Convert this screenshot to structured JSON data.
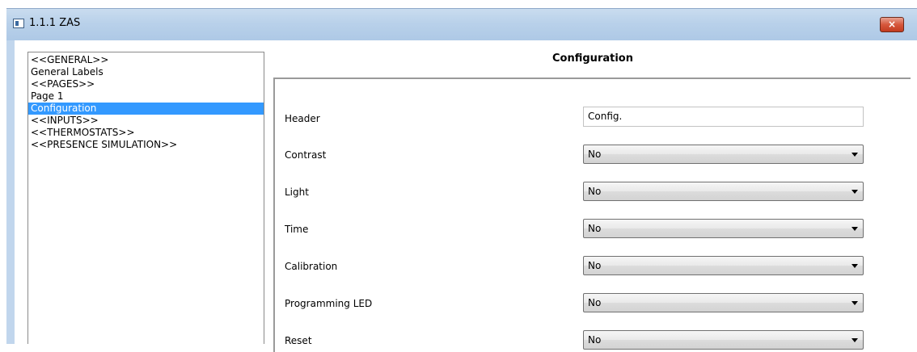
{
  "window": {
    "title": "1.1.1 ZAS",
    "close_label": "×"
  },
  "sidebar": {
    "items": [
      {
        "label": "<<GENERAL>>",
        "selected": false
      },
      {
        "label": "General Labels",
        "selected": false
      },
      {
        "label": "<<PAGES>>",
        "selected": false
      },
      {
        "label": "Page 1",
        "selected": false
      },
      {
        "label": "Configuration",
        "selected": true
      },
      {
        "label": "<<INPUTS>>",
        "selected": false
      },
      {
        "label": "<<THERMOSTATS>>",
        "selected": false
      },
      {
        "label": "<<PRESENCE SIMULATION>>",
        "selected": false
      }
    ]
  },
  "main": {
    "title": "Configuration",
    "params": [
      {
        "label": "Header",
        "type": "text",
        "value": "Config."
      },
      {
        "label": "Contrast",
        "type": "select",
        "value": "No"
      },
      {
        "label": "Light",
        "type": "select",
        "value": "No"
      },
      {
        "label": "Time",
        "type": "select",
        "value": "No"
      },
      {
        "label": "Calibration",
        "type": "select",
        "value": "No"
      },
      {
        "label": "Programming LED",
        "type": "select",
        "value": "No"
      },
      {
        "label": "Reset",
        "type": "select",
        "value": "No"
      }
    ]
  },
  "colors": {
    "selection": "#3399ff",
    "titlebar": "#b9d1ea",
    "close_button": "#c7432a"
  }
}
